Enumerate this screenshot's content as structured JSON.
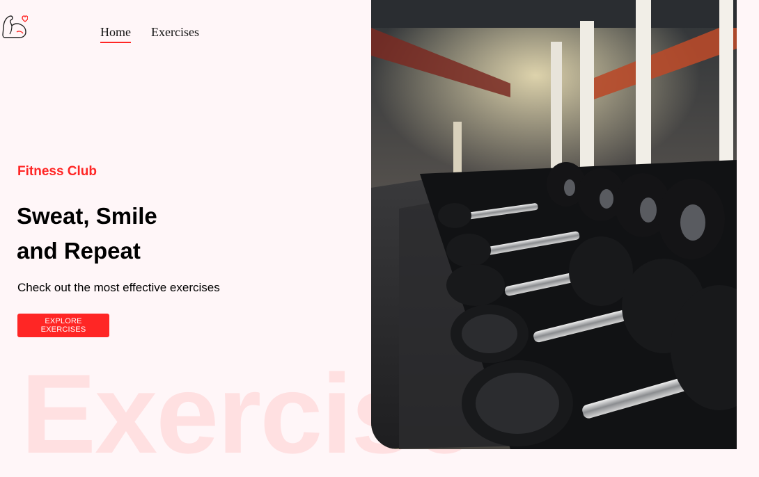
{
  "nav": {
    "items": [
      {
        "label": "Home",
        "active": true
      },
      {
        "label": "Exercises",
        "active": false
      }
    ]
  },
  "hero": {
    "eyebrow": "Fitness Club",
    "headline_line1": "Sweat, Smile",
    "headline_line2": "and Repeat",
    "subtext": "Check out the most effective exercises",
    "cta_label": "EXPLORE EXERCISES",
    "watermark": "Exercise",
    "image_alt": "gym dumbbell rack"
  },
  "colors": {
    "accent": "#ff2625",
    "background": "#fff6f8",
    "watermark": "#ffdfe3"
  },
  "icons": {
    "logo": "flexing-arm-heart-icon"
  }
}
